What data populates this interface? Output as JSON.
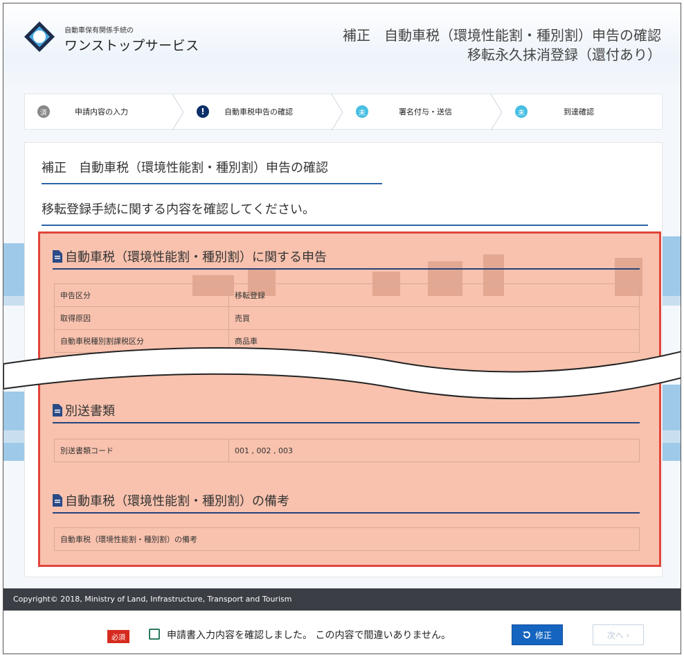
{
  "header": {
    "logo_sub": "自動車保有関係手続の",
    "logo_main": "ワンストップサービス",
    "title_line1": "補正　自動車税（環境性能割・種別割）申告の確認",
    "title_line2": "移転永久抹消登録（還付あり）"
  },
  "steps": [
    {
      "badge": "済",
      "label": "申請内容の入力",
      "state": "done"
    },
    {
      "badge": "!",
      "label": "自動車税申告の確認",
      "state": "current"
    },
    {
      "badge": "未",
      "label": "署名付与・送信",
      "state": "todo"
    },
    {
      "badge": "未",
      "label": "到達確認",
      "state": "todo"
    }
  ],
  "card": {
    "title": "補正　自動車税（環境性能割・種別割）申告の確認",
    "subtitle": "移転登録手続に関する内容を確認してください。"
  },
  "sections": {
    "declaration": {
      "heading": "自動車税（環境性能割・種別割）に関する申告",
      "rows": [
        {
          "key": "申告区分",
          "value": "移転登録"
        },
        {
          "key": "取得原因",
          "value": "売買"
        },
        {
          "key": "自動車税種別割課税区分",
          "value": "商品車"
        }
      ]
    },
    "separate_docs": {
      "heading": "別送書類",
      "rows": [
        {
          "key": "別送書類コード",
          "value": "001 , 002 , 003"
        }
      ]
    },
    "remarks": {
      "heading": "自動車税（環境性能割・種別割）の備考",
      "rows": [
        {
          "key": "自動車税（環境性能割・種別割）の備考"
        }
      ]
    }
  },
  "footer": {
    "copyright": "Copyright© 2018, Ministry of Land, Infrastructure, Transport and Tourism"
  },
  "actions": {
    "required_badge": "必須",
    "confirm_label": "申請書入力内容を確認しました。 この内容で間違いありません。",
    "fix_label": "修正",
    "next_label": "次へ ›"
  },
  "colors": {
    "accent_blue": "#1565c0",
    "highlight_border": "#e0453a",
    "highlight_fill": "#f28b64",
    "current_step": "#0d2f6a",
    "todo_step": "#47bfe3"
  }
}
